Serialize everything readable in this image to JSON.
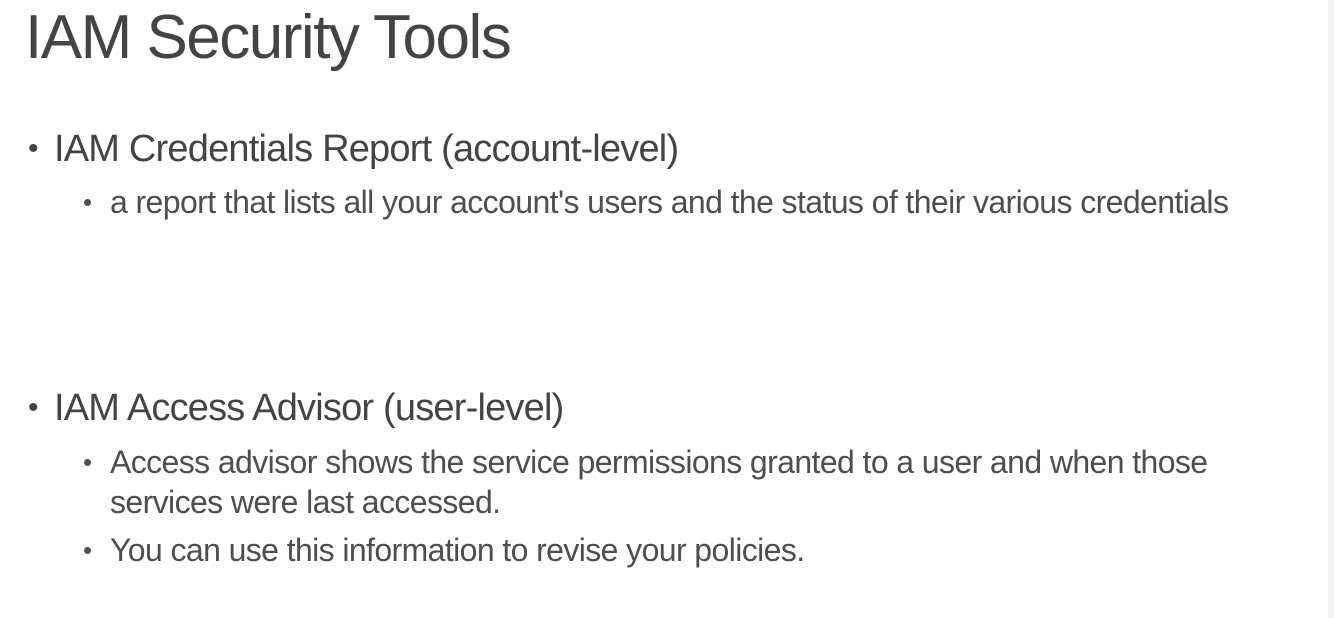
{
  "slide": {
    "title": "IAM Security Tools",
    "sections": [
      {
        "heading": "IAM Credentials Report (account-level)",
        "items": [
          "a report that lists all your account's users and the status of their various credentials"
        ]
      },
      {
        "heading": "IAM Access Advisor (user-level)",
        "items": [
          "Access advisor shows the service permissions granted to a user and when those services were last accessed.",
          "You can use this information to revise your policies."
        ]
      }
    ],
    "bullet_glyph": "•"
  }
}
